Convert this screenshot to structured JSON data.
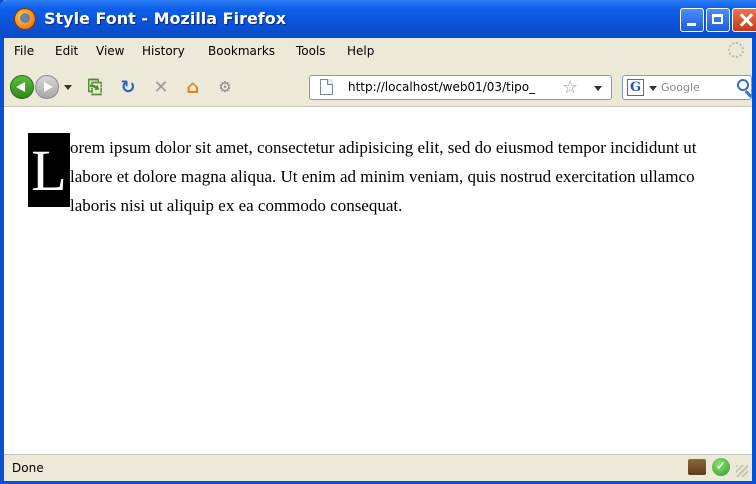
{
  "window": {
    "title": "Style Font - Mozilla Firefox"
  },
  "menu": {
    "items": [
      {
        "label": "File"
      },
      {
        "label": "Edit"
      },
      {
        "label": "View"
      },
      {
        "label": "History"
      },
      {
        "label": "Bookmarks"
      },
      {
        "label": "Tools"
      },
      {
        "label": "Help"
      }
    ]
  },
  "navigation": {
    "url": "http://localhost/web01/03/tipo_",
    "search_placeholder": "Google"
  },
  "content": {
    "drop_cap": "L",
    "paragraph_rest": "orem ipsum dolor sit amet, consectetur adipisicing elit, sed do eiusmod tempor incididunt ut labore et dolore magna aliqua. Ut enim ad minim veniam, quis nostrud exercitation ullamco laboris nisi ut aliquip ex ea commodo consequat."
  },
  "status": {
    "text": "Done"
  },
  "colors": {
    "titlebar": "#0a53d8",
    "chrome": "#ece9d8",
    "dropcap_bg": "#000000",
    "dropcap_fg": "#ffffff"
  }
}
